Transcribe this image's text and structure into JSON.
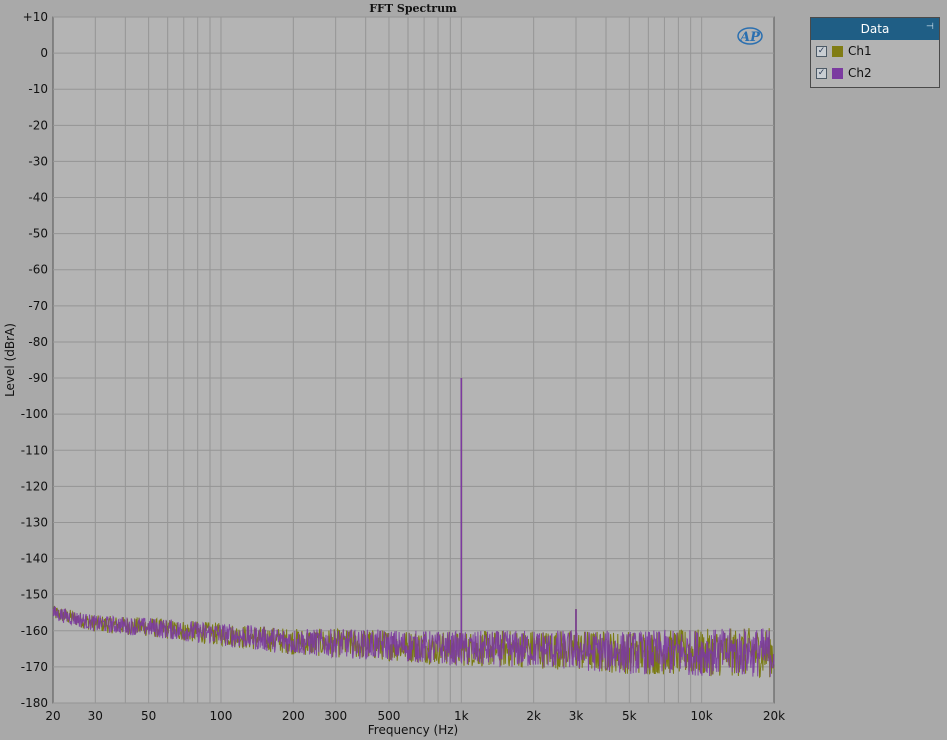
{
  "chart_data": {
    "type": "line",
    "title": "FFT Spectrum",
    "xlabel": "Frequency (Hz)",
    "ylabel": "Level (dBrA)",
    "xscale": "log",
    "xlim": [
      20,
      20000
    ],
    "ylim": [
      -180,
      10
    ],
    "xticks": [
      {
        "value": 20,
        "label": "20"
      },
      {
        "value": 30,
        "label": "30"
      },
      {
        "value": 50,
        "label": "50"
      },
      {
        "value": 100,
        "label": "100"
      },
      {
        "value": 200,
        "label": "200"
      },
      {
        "value": 300,
        "label": "300"
      },
      {
        "value": 500,
        "label": "500"
      },
      {
        "value": 1000,
        "label": "1k"
      },
      {
        "value": 2000,
        "label": "2k"
      },
      {
        "value": 3000,
        "label": "3k"
      },
      {
        "value": 5000,
        "label": "5k"
      },
      {
        "value": 10000,
        "label": "10k"
      },
      {
        "value": 20000,
        "label": "20k"
      }
    ],
    "yticks": [
      {
        "value": 10,
        "label": "+10"
      },
      {
        "value": 0,
        "label": "0"
      },
      {
        "value": -10,
        "label": "-10"
      },
      {
        "value": -20,
        "label": "-20"
      },
      {
        "value": -30,
        "label": "-30"
      },
      {
        "value": -40,
        "label": "-40"
      },
      {
        "value": -50,
        "label": "-50"
      },
      {
        "value": -60,
        "label": "-60"
      },
      {
        "value": -70,
        "label": "-70"
      },
      {
        "value": -80,
        "label": "-80"
      },
      {
        "value": -90,
        "label": "-90"
      },
      {
        "value": -100,
        "label": "-100"
      },
      {
        "value": -110,
        "label": "-110"
      },
      {
        "value": -120,
        "label": "-120"
      },
      {
        "value": -130,
        "label": "-130"
      },
      {
        "value": -140,
        "label": "-140"
      },
      {
        "value": -150,
        "label": "-150"
      },
      {
        "value": -160,
        "label": "-160"
      },
      {
        "value": -170,
        "label": "-170"
      },
      {
        "value": -180,
        "label": "-180"
      }
    ],
    "grid": true,
    "noise_floor_points": [
      {
        "x": 20,
        "y": -155
      },
      {
        "x": 30,
        "y": -158
      },
      {
        "x": 50,
        "y": -159
      },
      {
        "x": 100,
        "y": -161
      },
      {
        "x": 200,
        "y": -163
      },
      {
        "x": 500,
        "y": -164
      },
      {
        "x": 1000,
        "y": -165
      },
      {
        "x": 2000,
        "y": -165
      },
      {
        "x": 5000,
        "y": -166
      },
      {
        "x": 10000,
        "y": -166
      },
      {
        "x": 20000,
        "y": -166
      }
    ],
    "series": [
      {
        "name": "Ch1",
        "color": "#7a7a12",
        "peaks": [
          {
            "x": 1000,
            "y": -90
          },
          {
            "x": 3000,
            "y": -154
          }
        ]
      },
      {
        "name": "Ch2",
        "color": "#7b3aa0",
        "peaks": [
          {
            "x": 1000,
            "y": -90
          },
          {
            "x": 3000,
            "y": -154
          }
        ]
      }
    ]
  },
  "legend": {
    "title": "Data",
    "items": [
      {
        "label": "Ch1",
        "checked": "✓",
        "color": "#807c14"
      },
      {
        "label": "Ch2",
        "checked": "✓",
        "color": "#7b3aa0"
      }
    ]
  },
  "logo": {
    "text": "AP"
  }
}
